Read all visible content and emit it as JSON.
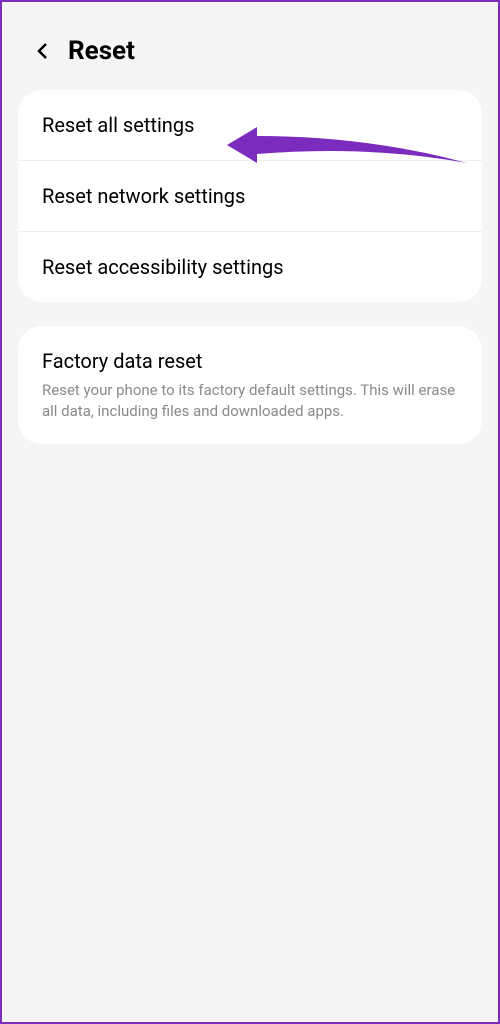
{
  "header": {
    "title": "Reset"
  },
  "groups": [
    {
      "items": [
        {
          "title": "Reset all settings"
        },
        {
          "title": "Reset network settings"
        },
        {
          "title": "Reset accessibility settings"
        }
      ]
    },
    {
      "items": [
        {
          "title": "Factory data reset",
          "description": "Reset your phone to its factory default settings. This will erase all data, including files and downloaded apps."
        }
      ]
    }
  ],
  "annotation": {
    "color": "#7b2cbf"
  }
}
